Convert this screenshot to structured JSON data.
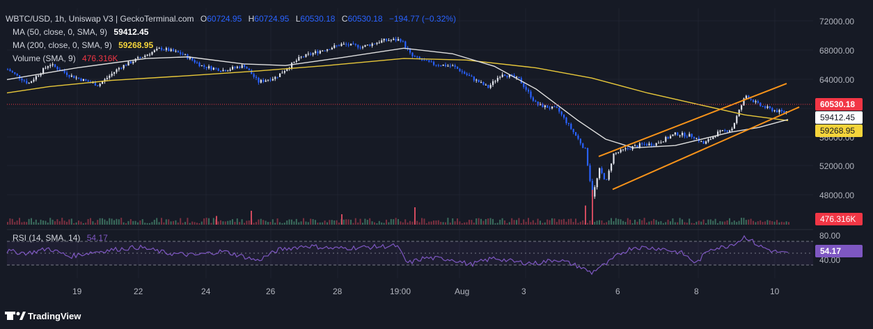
{
  "header": {
    "symbol_line": "WBTC/USD, 1h, Uniswap V3 | GeckoTerminal.com",
    "o_label": "O",
    "o_value": "60724.95",
    "h_label": "H",
    "h_value": "60724.95",
    "l_label": "L",
    "l_value": "60530.18",
    "c_label": "C",
    "c_value": "60530.18",
    "change": "−194.77 (−0.32%)"
  },
  "indicators": {
    "ma50_label": "MA (50, close, 0, SMA, 9)",
    "ma50_value": "59412.45",
    "ma200_label": "MA (200, close, 0, SMA, 9)",
    "ma200_value": "59268.95",
    "volume_label": "Volume (SMA, 9)",
    "volume_value": "476.316K",
    "rsi_label": "RSI (14, SMA, 14)",
    "rsi_value": "54.17"
  },
  "badges": {
    "price": "60530.18",
    "ma50": "59412.45",
    "ma200": "59268.95",
    "volume": "476.316K",
    "rsi": "54.17"
  },
  "branding": {
    "logo_text": "TradingView"
  },
  "colors": {
    "background": "#161a25",
    "up": "#e0e3eb",
    "down": "#2962ff",
    "ma50": "#e0e0e0",
    "ma200": "#e8c83a",
    "channel": "#f7931a",
    "price_badge": "#f23645",
    "rsi_line": "#7e57c2",
    "axis_text": "#b2b5be"
  },
  "chart_data": {
    "type": "candlestick",
    "y_axis_ticks": [
      "72000.00",
      "68000.00",
      "64000.00",
      "56000.00",
      "52000.00",
      "48000.00"
    ],
    "ylim": [
      46000,
      73500
    ],
    "x_axis_ticks": [
      "19",
      "22",
      "24",
      "26",
      "28",
      "19:00",
      "Aug",
      "3",
      "6",
      "8",
      "10"
    ],
    "rsi_axis_ticks": [
      "80.00",
      "40.00"
    ],
    "rsi_ylim": [
      20,
      90
    ],
    "price_points": [
      [
        0,
        65800
      ],
      [
        30,
        64000
      ],
      [
        60,
        66500
      ],
      [
        90,
        65000
      ],
      [
        130,
        63800
      ],
      [
        160,
        66000
      ],
      [
        190,
        67300
      ],
      [
        220,
        68500
      ],
      [
        250,
        67800
      ],
      [
        280,
        66200
      ],
      [
        310,
        65700
      ],
      [
        340,
        66300
      ],
      [
        360,
        64200
      ],
      [
        385,
        64800
      ],
      [
        420,
        67300
      ],
      [
        450,
        68200
      ],
      [
        480,
        69000
      ],
      [
        510,
        68700
      ],
      [
        540,
        69500
      ],
      [
        565,
        69600
      ],
      [
        580,
        67500
      ],
      [
        610,
        66500
      ],
      [
        640,
        66200
      ],
      [
        665,
        64800
      ],
      [
        690,
        63500
      ],
      [
        710,
        65300
      ],
      [
        735,
        64500
      ],
      [
        760,
        61300
      ],
      [
        790,
        60700
      ],
      [
        815,
        57500
      ],
      [
        830,
        55500
      ],
      [
        840,
        49600
      ],
      [
        850,
        53000
      ],
      [
        860,
        51500
      ],
      [
        870,
        55000
      ],
      [
        890,
        55700
      ],
      [
        910,
        56200
      ],
      [
        930,
        56300
      ],
      [
        960,
        57600
      ],
      [
        985,
        57300
      ],
      [
        1000,
        56300
      ],
      [
        1020,
        57700
      ],
      [
        1040,
        58200
      ],
      [
        1050,
        60400
      ],
      [
        1060,
        62500
      ],
      [
        1080,
        61200
      ],
      [
        1100,
        60600
      ],
      [
        1115,
        60300
      ],
      [
        1122,
        60530
      ]
    ],
    "ma50_points": [
      [
        0,
        64500
      ],
      [
        100,
        66000
      ],
      [
        200,
        67200
      ],
      [
        260,
        67400
      ],
      [
        340,
        66500
      ],
      [
        400,
        66300
      ],
      [
        480,
        67300
      ],
      [
        570,
        68500
      ],
      [
        640,
        67800
      ],
      [
        700,
        66200
      ],
      [
        760,
        63300
      ],
      [
        820,
        59300
      ],
      [
        860,
        56900
      ],
      [
        900,
        55800
      ],
      [
        960,
        56100
      ],
      [
        1040,
        57800
      ],
      [
        1080,
        58400
      ],
      [
        1122,
        59412
      ]
    ],
    "ma200_points": [
      [
        0,
        62800
      ],
      [
        60,
        63600
      ],
      [
        150,
        64400
      ],
      [
        260,
        65000
      ],
      [
        360,
        65600
      ],
      [
        460,
        66300
      ],
      [
        570,
        67200
      ],
      [
        660,
        67000
      ],
      [
        760,
        66000
      ],
      [
        840,
        64700
      ],
      [
        920,
        62800
      ],
      [
        1000,
        61200
      ],
      [
        1060,
        60000
      ],
      [
        1122,
        59269
      ]
    ],
    "channel_upper": [
      [
        850,
        54700
      ],
      [
        1120,
        64000
      ]
    ],
    "channel_lower": [
      [
        870,
        50500
      ],
      [
        1138,
        61000
      ]
    ],
    "volume_spikes": [
      {
        "x": 840,
        "v": 1.0
      },
      {
        "x": 830,
        "v": 0.55
      },
      {
        "x": 585,
        "v": 0.5
      },
      {
        "x": 350,
        "v": 0.4
      },
      {
        "x": 480,
        "v": 0.3
      },
      {
        "x": 300,
        "v": 0.25
      }
    ],
    "rsi_points": [
      [
        0,
        58
      ],
      [
        30,
        55
      ],
      [
        60,
        62
      ],
      [
        90,
        50
      ],
      [
        120,
        56
      ],
      [
        150,
        60
      ],
      [
        190,
        64
      ],
      [
        230,
        55
      ],
      [
        270,
        52
      ],
      [
        310,
        58
      ],
      [
        340,
        50
      ],
      [
        360,
        44
      ],
      [
        390,
        60
      ],
      [
        430,
        66
      ],
      [
        470,
        62
      ],
      [
        520,
        64
      ],
      [
        560,
        66
      ],
      [
        575,
        40
      ],
      [
        600,
        48
      ],
      [
        640,
        46
      ],
      [
        665,
        38
      ],
      [
        700,
        48
      ],
      [
        730,
        42
      ],
      [
        760,
        40
      ],
      [
        790,
        46
      ],
      [
        820,
        36
      ],
      [
        840,
        26
      ],
      [
        850,
        34
      ],
      [
        860,
        38
      ],
      [
        880,
        54
      ],
      [
        900,
        64
      ],
      [
        940,
        62
      ],
      [
        970,
        55
      ],
      [
        990,
        40
      ],
      [
        1010,
        62
      ],
      [
        1030,
        64
      ],
      [
        1050,
        72
      ],
      [
        1060,
        80
      ],
      [
        1080,
        66
      ],
      [
        1100,
        58
      ],
      [
        1122,
        54
      ]
    ]
  }
}
